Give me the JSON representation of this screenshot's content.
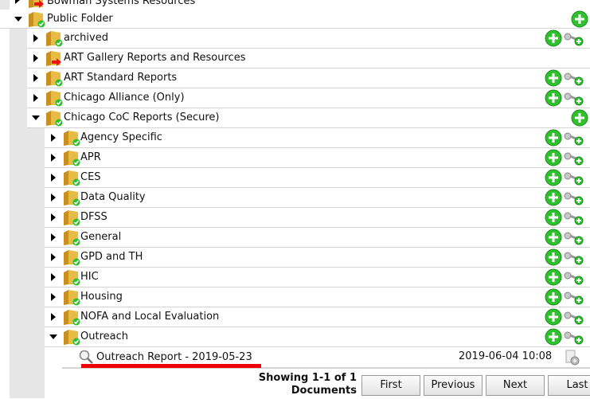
{
  "tree": {
    "top_partial": "Bowman Systems Resources",
    "public_folder": "Public Folder",
    "level1": [
      {
        "label": "archived",
        "actions": true
      },
      {
        "label": "ART Gallery Reports and Resources",
        "actions": false
      },
      {
        "label": "ART Standard Reports",
        "actions": true
      },
      {
        "label": "Chicago Alliance (Only)",
        "actions": true
      },
      {
        "label": "Chicago CoC Reports (Secure)",
        "actions": "plus"
      }
    ],
    "level2": [
      "Agency Specific",
      "APR",
      "CES",
      "Data Quality",
      "DFSS",
      "General",
      "GPD and TH",
      "HIC",
      "Housing",
      "NOFA and Local Evaluation",
      "Outreach"
    ]
  },
  "document": {
    "name": "Outreach Report - 2019-05-23",
    "date": "2019-06-04 10:08"
  },
  "pagination": {
    "showing": "Showing 1-1 of 1 Documents",
    "first": "First",
    "previous": "Previous",
    "next": "Next",
    "last": "Last"
  },
  "colors": {
    "accent_green": "#2fbf2f",
    "folder_yellow": "#e2b33a",
    "indent_grey": "#e6e6e6",
    "redact_red": "#ee0000"
  }
}
